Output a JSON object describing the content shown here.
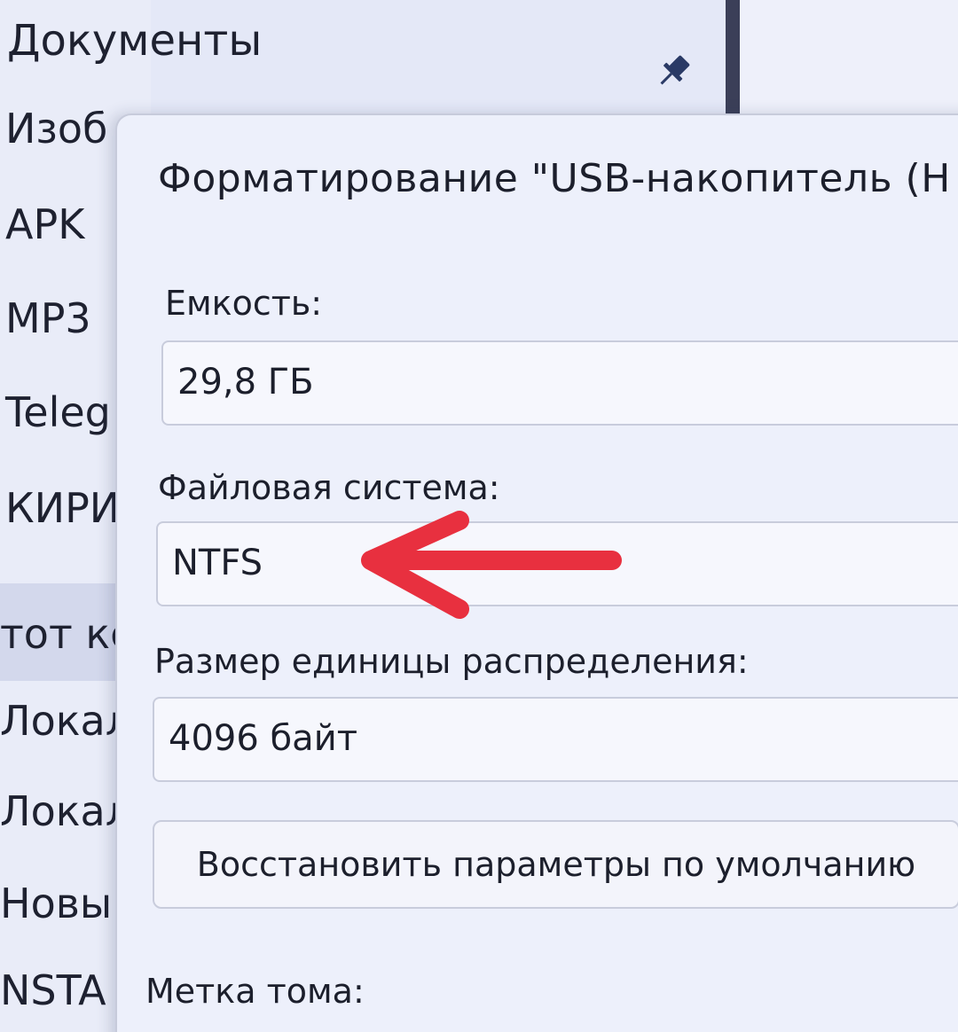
{
  "explorer": {
    "nav_items": [
      "Документы",
      "Изоб",
      "APK",
      "MP3",
      "Teleg",
      "КИРИ",
      "тот кс",
      "Локал",
      "Локал",
      "Новы",
      "NSTA"
    ]
  },
  "dialog": {
    "title": "Форматирование \"USB-накопитель (H",
    "capacity": {
      "label": "Емкость:",
      "value": "29,8 ГБ"
    },
    "filesystem": {
      "label": "Файловая система:",
      "value": "NTFS"
    },
    "allocation": {
      "label": "Размер единицы распределения:",
      "value": "4096 байт"
    },
    "restore_defaults_label": "Восстановить параметры по умолчанию",
    "volume_label": {
      "label": "Метка тома:"
    }
  },
  "colors": {
    "annotation_arrow": "#e8303f",
    "dialog_background": "#edf0fb",
    "divider": "#3b3f58"
  },
  "icons": {
    "pin": "pin-icon",
    "annotation": "arrow-left-annotation"
  }
}
